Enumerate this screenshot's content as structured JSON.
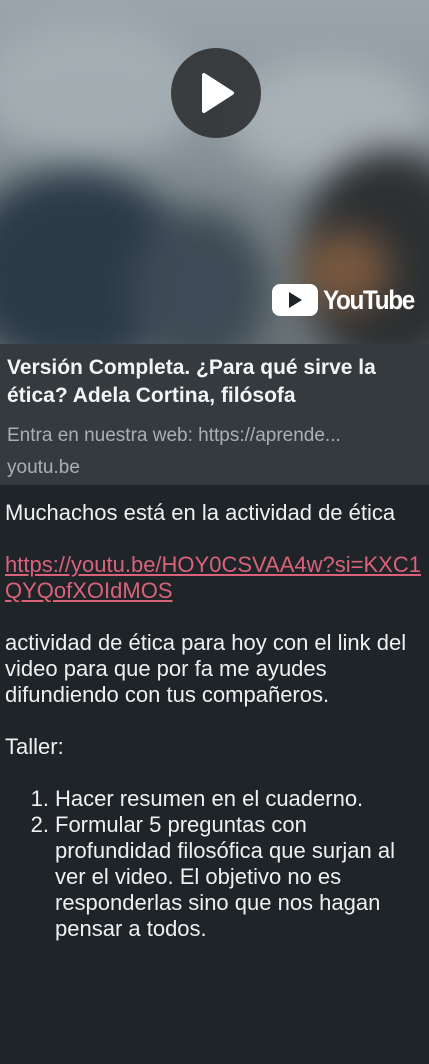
{
  "link_preview": {
    "brand_text": "YouTube",
    "title": "Versión Completa. ¿Para qué sirve la ética? Adela Cortina, filósofa",
    "description": "Entra en nuestra web: https://aprende...",
    "domain": "youtu.be",
    "icons": [
      "play-icon",
      "youtube-logo-icon"
    ]
  },
  "message": {
    "intro": "Muchachos está en la actividad de ética",
    "link": "https://youtu.be/HOY0CSVAA4w?si=KXC1QYQofXOIdMOS",
    "body": "actividad de ética para hoy con el link del video para que por fa me ayudes difundiendo con tus compañeros.",
    "taller_label": "Taller:",
    "items": [
      {
        "num": "1.",
        "text": "Hacer resumen en el cuaderno."
      },
      {
        "num": "2.",
        "text": "Formular 5 preguntas con profundidad filosófica que surjan al ver el video. El objetivo no es responderlas sino que nos hagan pensar a todos."
      }
    ]
  },
  "colors": {
    "background": "#1f2428",
    "card": "#353a3e",
    "link": "#d9627a"
  }
}
